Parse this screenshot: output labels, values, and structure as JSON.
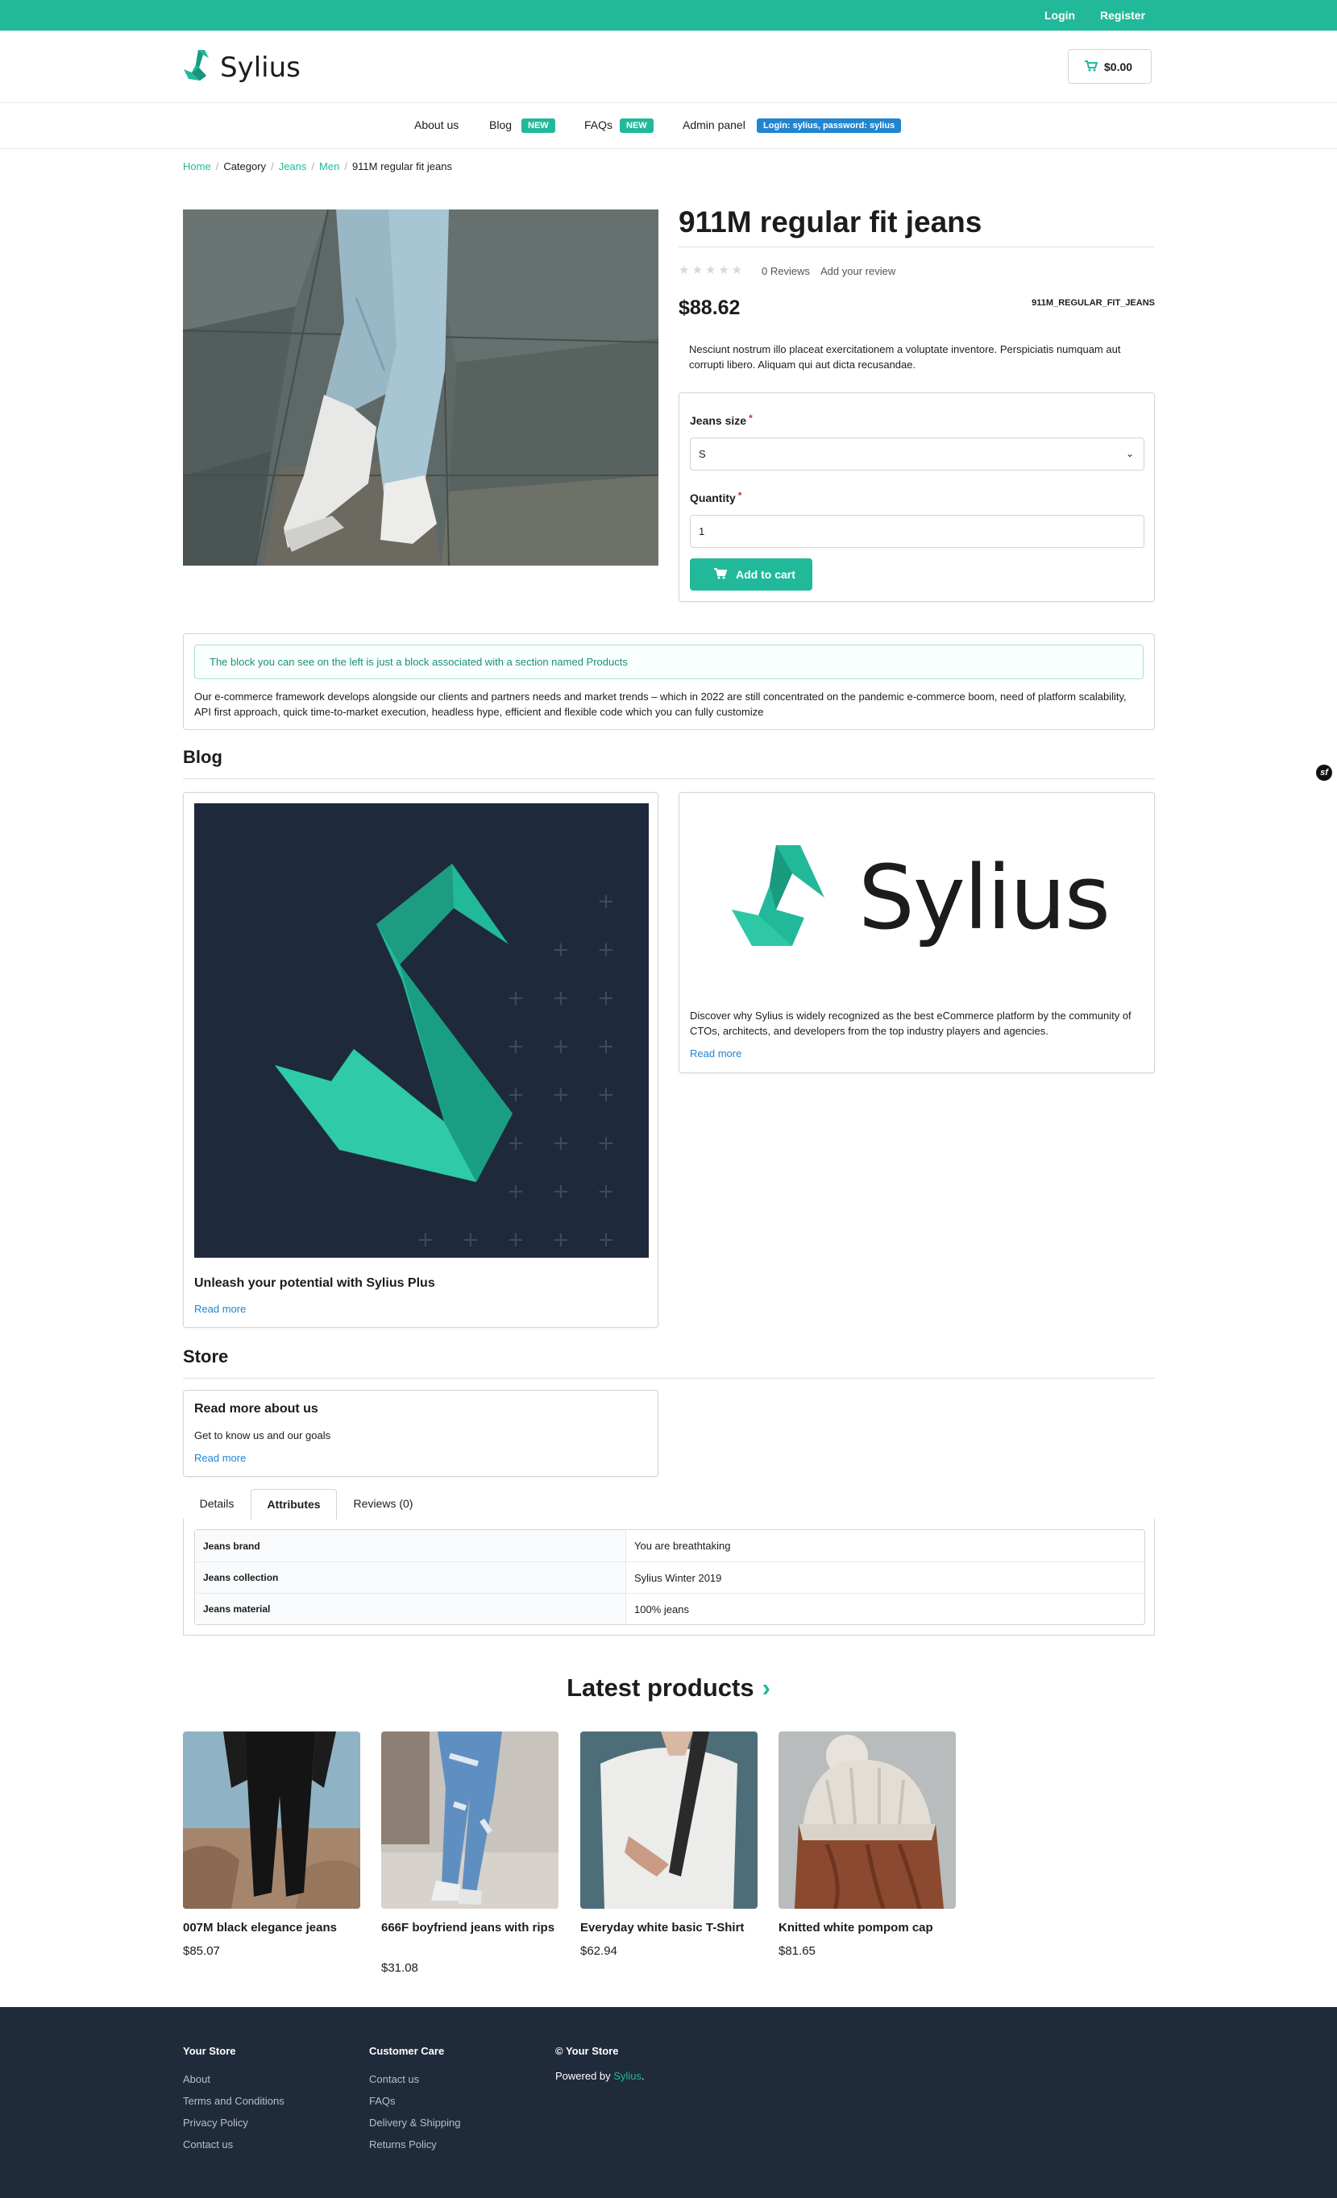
{
  "topbar": {
    "login": "Login",
    "register": "Register"
  },
  "header": {
    "logo_text": "Sylius",
    "cart_total": "$0.00"
  },
  "nav": {
    "about": "About us",
    "blog": "Blog",
    "blog_badge": "NEW",
    "faqs": "FAQs",
    "faqs_badge": "NEW",
    "admin": "Admin panel",
    "admin_badge": "Login: sylius, password: sylius"
  },
  "breadcrumb": [
    "Home",
    "Category",
    "Jeans",
    "Men",
    "911M regular fit jeans"
  ],
  "product": {
    "title": "911M regular fit jeans",
    "stars": "★★★★★",
    "reviews_count": "0 Reviews",
    "add_review": "Add your review",
    "price": "$88.62",
    "sku": "911M_REGULAR_FIT_JEANS",
    "description": "Nesciunt nostrum illo placeat exercitationem a voluptate inventore. Perspiciatis numquam aut corrupti libero. Aliquam qui aut dicta recusandae.",
    "size_label": "Jeans size",
    "size_value": "S",
    "quantity_label": "Quantity",
    "quantity_value": "1",
    "add_to_cart": "Add to cart"
  },
  "info_block": {
    "message": "The block you can see on the left is just a block associated with a section named Products",
    "text": "Our e-commerce framework develops alongside our clients and partners needs and market trends – which in 2022 are still concentrated on the pandemic e-commerce boom, need of platform scalability, API first approach, quick time-to-market execution, headless hype, efficient and flexible code which you can fully customize"
  },
  "blog": {
    "heading": "Blog",
    "posts": [
      {
        "title": "Unleash your potential with Sylius Plus",
        "read_more": "Read more"
      },
      {
        "logo_text": "Sylius",
        "text": "Discover why Sylius is widely recognized as the best eCommerce platform by the community of CTOs, architects, and developers from the top industry players and agencies.",
        "read_more": "Read more"
      }
    ]
  },
  "store": {
    "heading": "Store",
    "card_title": "Read more about us",
    "card_text": "Get to know us and our goals",
    "read_more": "Read more"
  },
  "tabs": {
    "details": "Details",
    "attributes": "Attributes",
    "reviews": "Reviews (0)"
  },
  "attributes": [
    {
      "name": "Jeans brand",
      "value": "You are breathtaking"
    },
    {
      "name": "Jeans collection",
      "value": "Sylius Winter 2019"
    },
    {
      "name": "Jeans material",
      "value": "100% jeans"
    }
  ],
  "latest": {
    "heading": "Latest products",
    "arrow": "›",
    "products": [
      {
        "name": "007M black elegance jeans",
        "price": "$85.07"
      },
      {
        "name": "666F boyfriend jeans with rips",
        "price": "$31.08"
      },
      {
        "name": "Everyday white basic T-Shirt",
        "price": "$62.94"
      },
      {
        "name": "Knitted white pompom cap",
        "price": "$81.65"
      }
    ]
  },
  "footer": {
    "col1_title": "Your Store",
    "col1_links": [
      "About",
      "Terms and Conditions",
      "Privacy Policy",
      "Contact us"
    ],
    "col2_title": "Customer Care",
    "col2_links": [
      "Contact us",
      "FAQs",
      "Delivery & Shipping",
      "Returns Policy"
    ],
    "col3_title": "© Your Store",
    "powered_prefix": "Powered by",
    "powered_link": "Sylius",
    "powered_suffix": "."
  },
  "colors": {
    "brand": "#22b99a",
    "link": "#2185d0",
    "footer_bg": "#1f2a3b",
    "badge_blue": "#2185d0"
  },
  "icons": {
    "cart": "cart-icon",
    "debug": "symfony-icon"
  }
}
